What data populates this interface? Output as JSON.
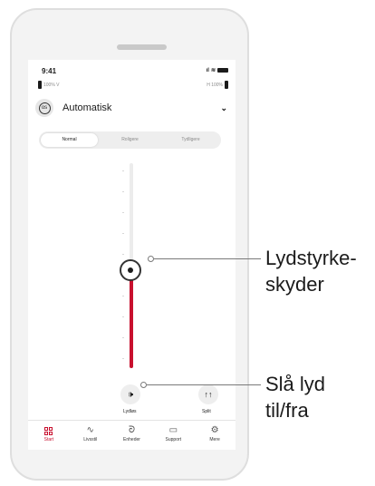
{
  "status": {
    "time": "9:41"
  },
  "battery": {
    "left": "100% V",
    "right": "H 100%"
  },
  "program": {
    "icon": "os",
    "name": "Automatisk"
  },
  "segments": [
    {
      "label": "Normal",
      "active": true
    },
    {
      "label": "Roligere",
      "active": false
    },
    {
      "label": "Tydligere",
      "active": false
    }
  ],
  "volume": {
    "level": 0.48
  },
  "controls": {
    "mute_label": "Lydløs",
    "split_label": "Split"
  },
  "tabs": [
    {
      "label": "Start",
      "icon": "grid-icon"
    },
    {
      "label": "Livsstil",
      "icon": "activity-icon"
    },
    {
      "label": "Enheder",
      "icon": "hearing-aid-icon"
    },
    {
      "label": "Support",
      "icon": "chat-icon"
    },
    {
      "label": "Mere",
      "icon": "gear-icon"
    }
  ],
  "callouts": {
    "slider": [
      "Lydstyrke-",
      "skyder"
    ],
    "mute": [
      "Slå lyd",
      "til/fra"
    ]
  },
  "colors": {
    "accent": "#c8102e"
  }
}
